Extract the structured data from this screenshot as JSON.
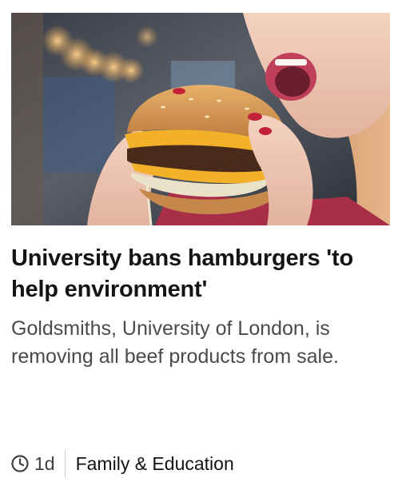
{
  "article": {
    "image_alt": "Woman eating a hamburger",
    "headline": "University bans hamburgers 'to help environment'",
    "summary": "Goldsmiths, University of London, is removing all beef products from sale.",
    "timestamp": "1d",
    "section": "Family & Education",
    "clock_icon": "clock-icon"
  }
}
